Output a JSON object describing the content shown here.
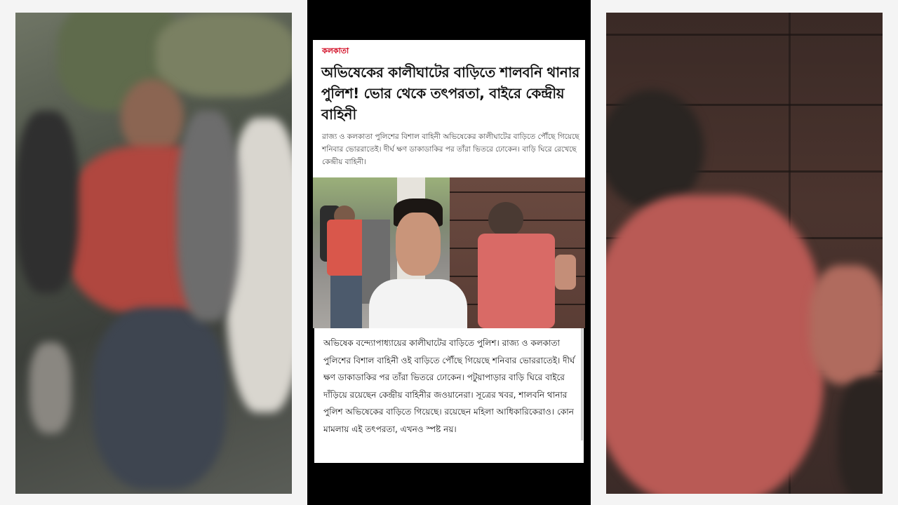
{
  "article": {
    "category": "কলকাতা",
    "headline": "অভিষেকের কালীঘাটের বাড়িতে শালবনি থানার পুলিশ! ভোর থেকে তৎপরতা, বাইরে কেন্দ্রীয় বাহিনী",
    "summary": "রাজ্য ও কলকাতা পুলিশের বিশাল বাহিনী অভিষেকের কালীঘাটের বাড়িতে পৌঁছে গিয়েছে শনিবার ভোররাতেই। দীর্ঘ ক্ষণ ডাকাডাকির পর তাঁরা ভিতরে ঢোকেন। বাড়ি ঘিরে রেখেছে কেন্দ্রীয় বাহিনী।",
    "body": "অভিষেক বন্দ্যোপাধ্যায়ের কালীঘাটের বাড়িতে পুলিশ। রাজ্য ও কলকাতা পুলিশের বিশাল বাহিনী ওই বাড়িতে পৌঁছে গিয়েছে শনিবার ভোররাতেই। দীর্ঘ ক্ষণ ডাকাডাকির পর তাঁরা ভিতরে ঢোকেন। পটুয়াপাড়ার বাড়ি ঘিরে বাইরে দাঁড়িয়ে রয়েছেন কেন্দ্রীয় বাহিনীর জওয়ানেরা। সূত্রের খবর, শালবনি থানার পুলিশ অভিষেকের বাড়িতে গিয়েছে। রয়েছেন মহিলা আধিকারিকেরাও। কোন মামলায় এই তৎপরতা, এখনও স্পষ্ট নয়।"
  },
  "colors": {
    "category": "#d0021b",
    "headline": "#111111",
    "summary": "#444444"
  }
}
